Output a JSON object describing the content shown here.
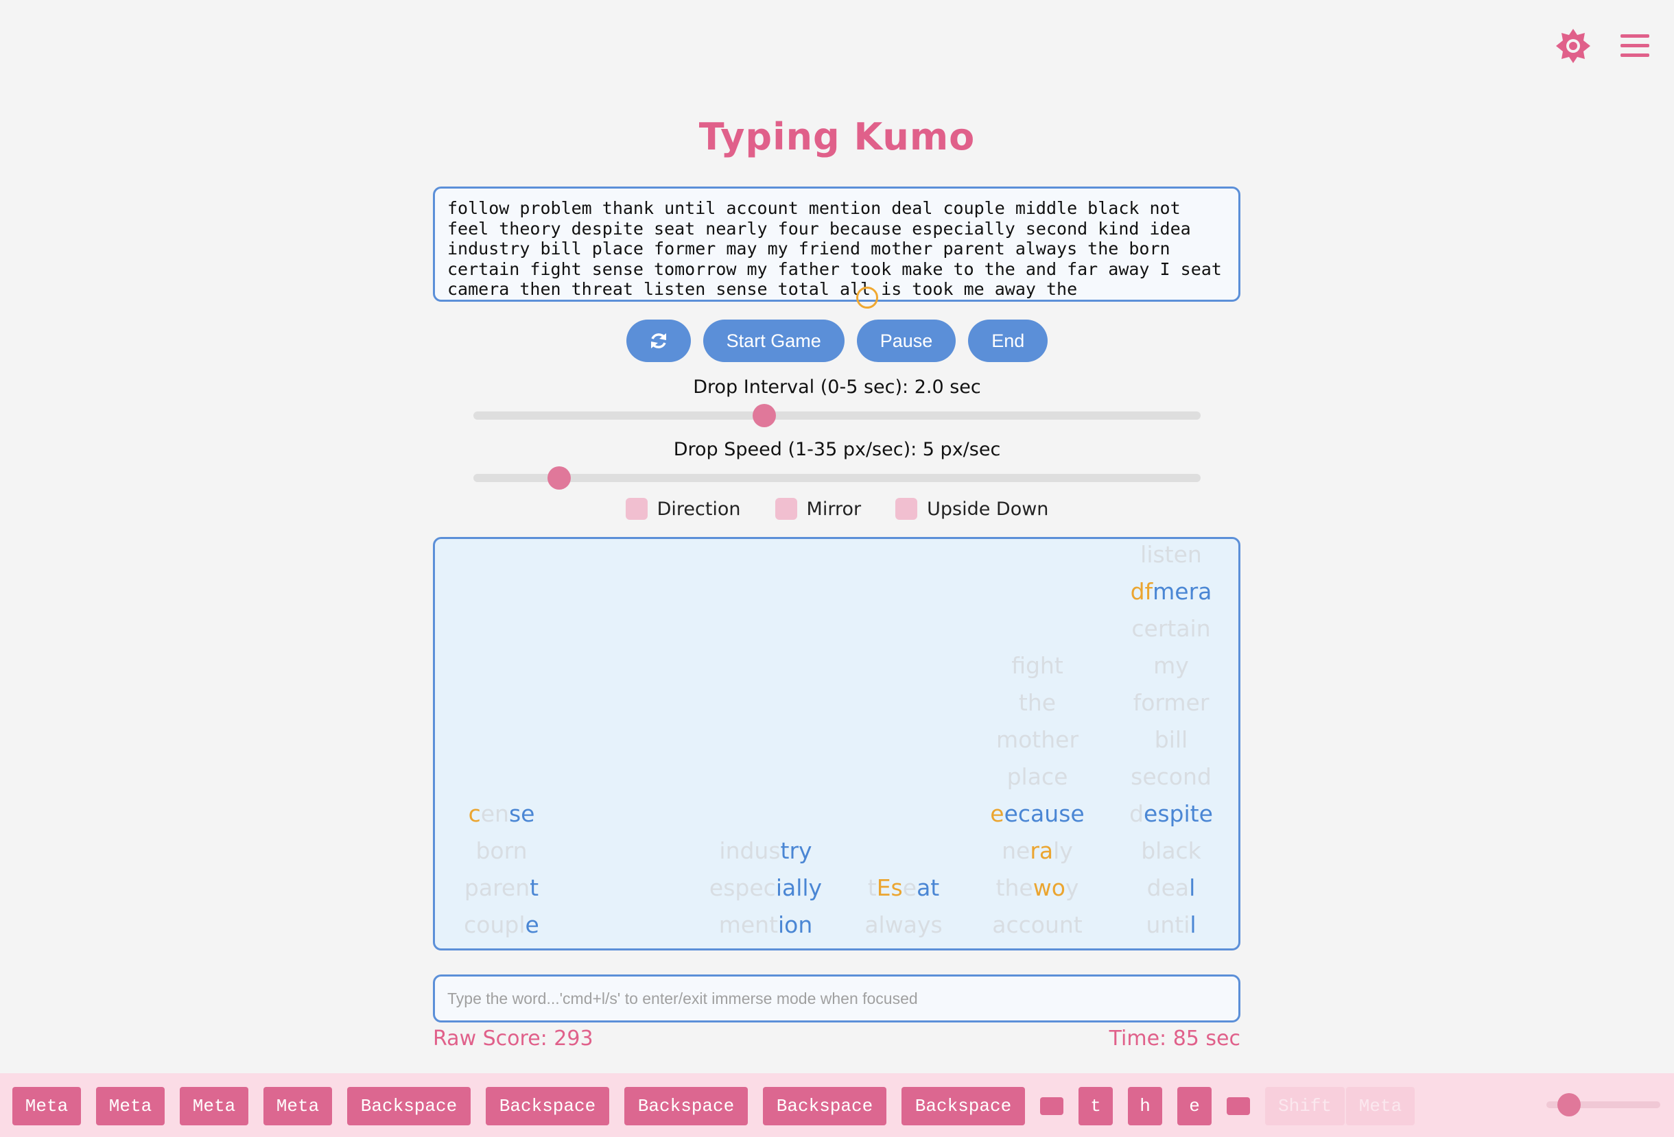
{
  "header": {
    "title": "Typing Kumo",
    "icons": [
      "settings-gear-icon",
      "hamburger-menu-icon"
    ],
    "accent_color": "#e0608a"
  },
  "source_text": "follow problem thank until account mention deal couple middle black not feel theory despite seat nearly four because especially second kind idea industry bill place former may my friend mother parent always the born certain fight sense tomorrow my father took make to the and far away I seat camera then threat listen sense total all is took me away the",
  "controls": {
    "refresh_icon": "refresh-icon",
    "start_label": "Start Game",
    "pause_label": "Pause",
    "end_label": "End",
    "button_color": "#5b8fd8"
  },
  "drop_interval": {
    "label": "Drop Interval (0-5 sec): 2.0 sec",
    "value": 2.0,
    "min": 0,
    "max": 5
  },
  "drop_speed": {
    "label": "Drop Speed (1-35 px/sec): 5 px/sec",
    "value": 5,
    "min": 1,
    "max": 35
  },
  "options": {
    "direction_label": "Direction",
    "mirror_label": "Mirror",
    "upside_down_label": "Upside Down"
  },
  "columns": [
    {
      "words": [
        [
          [
            "c",
            "o"
          ],
          [
            "en",
            "g"
          ],
          [
            "se",
            "b"
          ]
        ],
        [
          [
            "born",
            "g"
          ]
        ],
        [
          [
            "paren",
            "g"
          ],
          [
            "t",
            "b"
          ]
        ],
        [
          [
            "coupl",
            "g"
          ],
          [
            "e",
            "b"
          ]
        ]
      ]
    },
    {
      "words": [
        [
          [
            "indus",
            "g"
          ],
          [
            "try",
            "b"
          ]
        ],
        [
          [
            "espec",
            "g"
          ],
          [
            "ially",
            "b"
          ]
        ],
        [
          [
            "ment",
            "g"
          ],
          [
            "ion",
            "b"
          ]
        ]
      ]
    },
    {
      "words": [
        [
          [
            "t",
            "g"
          ],
          [
            "Es",
            "o"
          ],
          [
            "e",
            "g"
          ],
          [
            "at",
            "b"
          ]
        ],
        [
          [
            "always",
            "g"
          ]
        ]
      ]
    },
    {
      "words": [
        [
          [
            "fight",
            "g"
          ]
        ],
        [
          [
            "the",
            "g"
          ]
        ],
        [
          [
            "mother",
            "g"
          ]
        ],
        [
          [
            "place",
            "g"
          ]
        ],
        [
          [
            "e",
            "o"
          ],
          [
            "ecause",
            "b"
          ]
        ],
        [
          [
            "ne",
            "g"
          ],
          [
            "ra",
            "o"
          ],
          [
            "ly",
            "g"
          ]
        ],
        [
          [
            "the",
            "g"
          ],
          [
            "wo",
            "o"
          ],
          [
            "y",
            "g"
          ]
        ],
        [
          [
            "account",
            "g"
          ]
        ]
      ]
    },
    {
      "words": [
        [
          [
            "listen",
            "g"
          ]
        ],
        [
          [
            "df",
            "o"
          ],
          [
            "mera",
            "b"
          ]
        ],
        [
          [
            "certain",
            "g"
          ]
        ],
        [
          [
            "my",
            "g"
          ]
        ],
        [
          [
            "former",
            "g"
          ]
        ],
        [
          [
            "bill",
            "g"
          ]
        ],
        [
          [
            "second",
            "g"
          ]
        ],
        [
          [
            "d",
            "g"
          ],
          [
            "espite",
            "b"
          ]
        ],
        [
          [
            "black",
            "g"
          ]
        ],
        [
          [
            "dea",
            "g"
          ],
          [
            "l",
            "b"
          ]
        ],
        [
          [
            "unti",
            "g"
          ],
          [
            "l",
            "b"
          ]
        ]
      ]
    }
  ],
  "input": {
    "placeholder": "Type the word...'cmd+l/s' to enter/exit immerse mode when focused",
    "value": ""
  },
  "stats": {
    "raw_score_label": "Raw Score: 293",
    "time_label": "Time: 85 sec"
  },
  "keys": [
    {
      "label": "Meta"
    },
    {
      "label": "Meta"
    },
    {
      "label": "Meta"
    },
    {
      "label": "Meta"
    },
    {
      "label": "Backspace"
    },
    {
      "label": "Backspace"
    },
    {
      "label": "Backspace"
    },
    {
      "label": "Backspace"
    },
    {
      "label": "Backspace"
    },
    {
      "label": ""
    },
    {
      "label": "t"
    },
    {
      "label": "h"
    },
    {
      "label": "e"
    },
    {
      "label": ""
    },
    {
      "label": "Shift",
      "faded": true
    },
    {
      "label": "Meta",
      "faded": true
    }
  ],
  "volume": {
    "value": 0.2
  }
}
